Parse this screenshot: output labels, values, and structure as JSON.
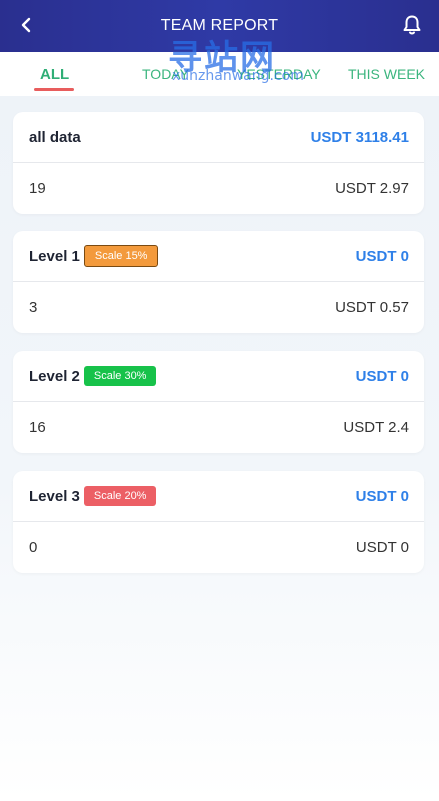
{
  "header": {
    "title": "TEAM REPORT",
    "back_icon": "chevron-left-icon",
    "bell_icon": "bell-icon"
  },
  "watermark": {
    "cn": "寻站网",
    "en": "xunzhanwang.com"
  },
  "tabs": [
    {
      "label": "ALL",
      "active": true
    },
    {
      "label": "TODAY",
      "active": false
    },
    {
      "label": "YESTERDAY",
      "active": false
    },
    {
      "label": "THIS WEEK",
      "active": false
    }
  ],
  "cards": [
    {
      "label": "all data",
      "badge": "",
      "badge_color": "",
      "amount": "USDT 3118.41",
      "count": "19",
      "sub_amount": "USDT 2.97"
    },
    {
      "label": "Level 1",
      "badge": "Scale 15%",
      "badge_color": "#f39a3c",
      "amount": "USDT 0",
      "count": "3",
      "sub_amount": "USDT 0.57"
    },
    {
      "label": "Level 2",
      "badge": "Scale 30%",
      "badge_color": "#17c24a",
      "amount": "USDT 0",
      "count": "16",
      "sub_amount": "USDT 2.4"
    },
    {
      "label": "Level 3",
      "badge": "Scale 20%",
      "badge_color": "#ec5f65",
      "amount": "USDT 0",
      "count": "0",
      "sub_amount": "USDT 0"
    }
  ],
  "colors": {
    "header_bg": "#2f3aa6",
    "tab_active": "#2fae76",
    "tab_underline": "#e85d5d",
    "amount": "#2f80e8"
  }
}
